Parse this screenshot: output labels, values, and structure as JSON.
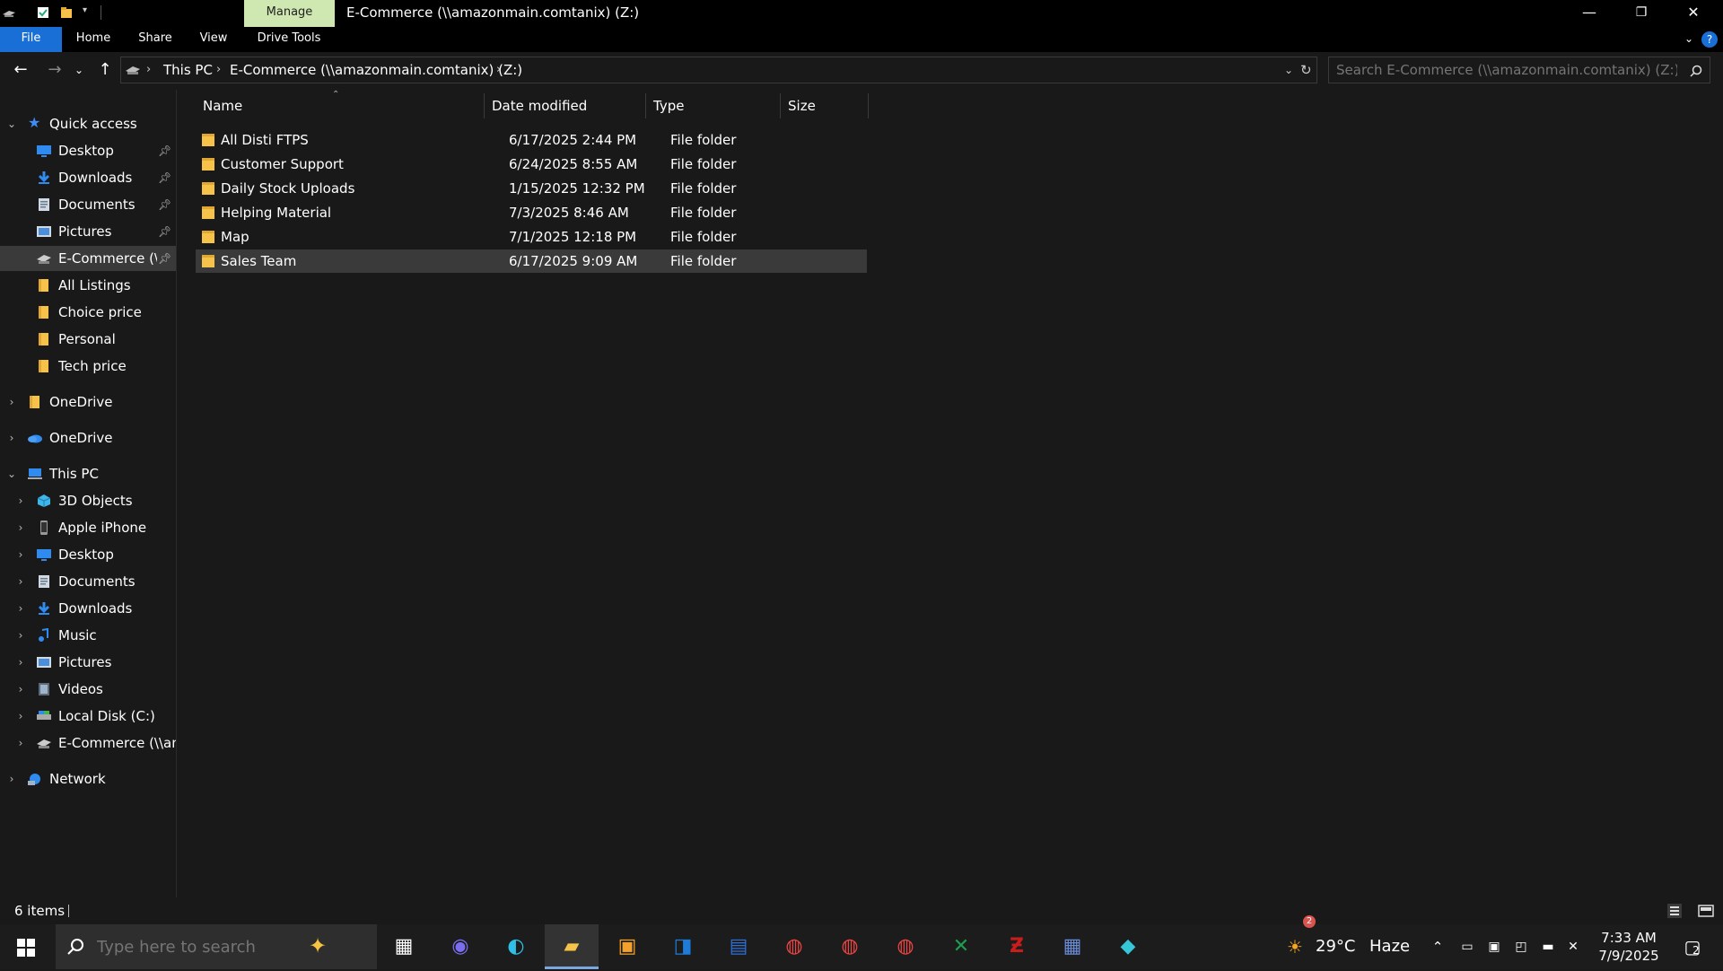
{
  "titlebar": {
    "manage_label": "Manage",
    "window_title": "E-Commerce (\\\\amazonmain.comtanix) (Z:)",
    "minimize": "—",
    "restore": "❐",
    "close": "✕"
  },
  "ribbon": {
    "tabs": [
      "File",
      "Home",
      "Share",
      "View",
      "Drive Tools"
    ],
    "help": "?"
  },
  "address": {
    "crumbs": [
      "This PC",
      "E-Commerce (\\\\amazonmain.comtanix) (Z:)"
    ],
    "search_placeholder": "Search E-Commerce (\\\\amazonmain.comtanix) (Z:)"
  },
  "nav": {
    "quick_access": "Quick access",
    "qa_items": [
      {
        "label": "Desktop",
        "icon": "desktop-icon",
        "pinned": true
      },
      {
        "label": "Downloads",
        "icon": "downloads-icon",
        "pinned": true
      },
      {
        "label": "Documents",
        "icon": "documents-icon",
        "pinned": true
      },
      {
        "label": "Pictures",
        "icon": "pictures-icon",
        "pinned": true
      },
      {
        "label": "E-Commerce (\\\\amazonmain.comtanix) (Z:)",
        "icon": "network-drive-icon",
        "pinned": true,
        "selected": true
      },
      {
        "label": "All Listings",
        "icon": "folder-icon"
      },
      {
        "label": "Choice price",
        "icon": "folder-icon"
      },
      {
        "label": "Personal",
        "icon": "folder-icon"
      },
      {
        "label": "Tech price",
        "icon": "folder-icon"
      }
    ],
    "onedrive_1": "OneDrive",
    "onedrive_2": "OneDrive",
    "this_pc": "This PC",
    "pc_items": [
      {
        "label": "3D Objects",
        "icon": "3d-objects-icon"
      },
      {
        "label": "Apple iPhone",
        "icon": "phone-icon"
      },
      {
        "label": "Desktop",
        "icon": "desktop-icon"
      },
      {
        "label": "Documents",
        "icon": "documents-icon"
      },
      {
        "label": "Downloads",
        "icon": "downloads-icon"
      },
      {
        "label": "Music",
        "icon": "music-icon"
      },
      {
        "label": "Pictures",
        "icon": "pictures-icon"
      },
      {
        "label": "Videos",
        "icon": "videos-icon"
      },
      {
        "label": "Local Disk (C:)",
        "icon": "local-disk-icon"
      },
      {
        "label": "E-Commerce (\\\\amazonmain.comtanix) (Z:)",
        "icon": "network-drive-icon"
      }
    ],
    "network": "Network"
  },
  "content": {
    "columns": [
      "Name",
      "Date modified",
      "Type",
      "Size"
    ],
    "rows": [
      {
        "name": "All Disti FTPS",
        "date": "6/17/2025 2:44 PM",
        "type": "File folder",
        "size": ""
      },
      {
        "name": "Customer Support",
        "date": "6/24/2025 8:55 AM",
        "type": "File folder",
        "size": ""
      },
      {
        "name": "Daily Stock Uploads",
        "date": "1/15/2025 12:32 PM",
        "type": "File folder",
        "size": ""
      },
      {
        "name": "Helping Material",
        "date": "7/3/2025 8:46 AM",
        "type": "File folder",
        "size": ""
      },
      {
        "name": "Map",
        "date": "7/1/2025 12:18 PM",
        "type": "File folder",
        "size": ""
      },
      {
        "name": "Sales Team",
        "date": "6/17/2025 9:09 AM",
        "type": "File folder",
        "size": "",
        "selected": true
      }
    ]
  },
  "status": {
    "item_count": "6 items"
  },
  "taskbar": {
    "search_placeholder": "Type here to search",
    "weather_temp": "29°C",
    "weather_desc": "Haze",
    "weather_badge": "2",
    "time": "7:33 AM",
    "date": "7/9/2025",
    "notification_count": "2",
    "apps": [
      "task-view-icon",
      "copilot-icon",
      "edge-icon",
      "file-explorer-icon",
      "store-icon",
      "outlook-icon",
      "calendar-icon",
      "chrome-icon",
      "chrome-icon",
      "chrome-icon",
      "excel-icon",
      "filezilla-icon",
      "calculator-icon",
      "app-icon"
    ]
  },
  "colors": {
    "accent": "#1a6fd6",
    "folder": "#f6c24a",
    "manage_tab": "#cfe7b0"
  }
}
